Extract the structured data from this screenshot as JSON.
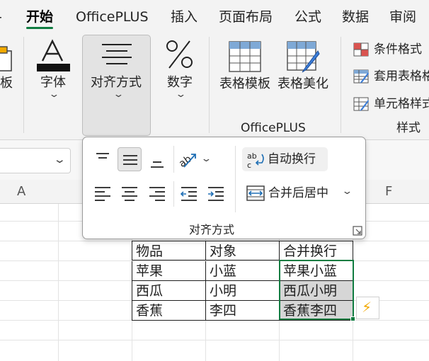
{
  "menu_tabs": [
    "开始",
    "OfficePLUS",
    "插入",
    "页面布局",
    "公式",
    "数据",
    "审阅"
  ],
  "ribbon": {
    "partial_group_label": "板",
    "font_label": "字体",
    "align_label": "对齐方式",
    "number_label": "数字",
    "table_template_label": "表格模板",
    "table_beautify_label": "表格美化",
    "officeplus_group_label": "OfficePLUS",
    "conditional_format_label": "条件格式",
    "apply_table_label": "套用表格格",
    "cell_style_label": "单元格样式",
    "styles_group_label": "样式",
    "chevron": "⌄"
  },
  "align_panel": {
    "wrap_text_label": "自动换行",
    "merge_center_label": "合并后居中",
    "group_title": "对齐方式",
    "wrap_glyph": "ab\nc",
    "merge_chevron": "⌄",
    "orient_chevron": "⌄",
    "launcher_glyph": "⬊"
  },
  "sheet": {
    "columns": [
      "A",
      "F"
    ],
    "table": {
      "header": [
        "物品",
        "对象",
        "合并换行"
      ],
      "rows": [
        [
          "苹果",
          "小蓝",
          "苹果小蓝"
        ],
        [
          "西瓜",
          "小明",
          "西瓜小明"
        ],
        [
          "香蕉",
          "李四",
          "香蕉李四"
        ]
      ]
    },
    "flash_fill_icon": "⚡"
  },
  "colors": {
    "accent": "#107c41",
    "flash": "#f2a900"
  }
}
